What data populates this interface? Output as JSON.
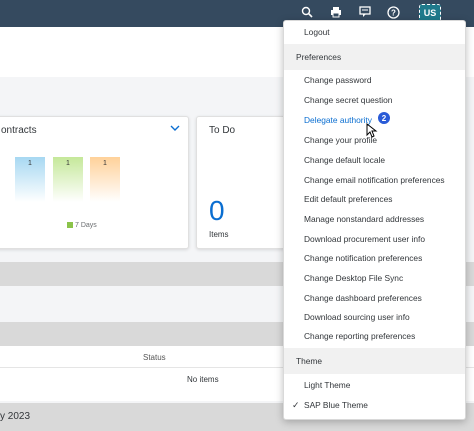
{
  "shell": {
    "avatar_initials": "US",
    "icons": [
      "search-icon",
      "printer-icon",
      "feedback-icon",
      "help-icon"
    ]
  },
  "cards": {
    "contracts": {
      "title": "ontracts",
      "bar_labels": [
        "1",
        "1",
        "1"
      ],
      "bar_colors": [
        "#a7d8f2",
        "#c5e89a",
        "#ffd19a"
      ],
      "legend": "7 Days"
    },
    "todo": {
      "title": "To Do",
      "count": "0",
      "count_label": "Items"
    }
  },
  "table": {
    "status_header": "Status",
    "empty_text": "No items"
  },
  "month_label": "y 2023",
  "menu": {
    "logout": "Logout",
    "preferences_header": "Preferences",
    "items": [
      "Change password",
      "Change secret question",
      "Delegate authority",
      "Change your profile",
      "Change default locale",
      "Change email notification preferences",
      "Edit default preferences",
      "Manage nonstandard addresses",
      "Download procurement user info",
      "Change notification preferences",
      "Change Desktop File Sync",
      "Change dashboard preferences",
      "Download sourcing user info",
      "Change reporting preferences"
    ],
    "theme_header": "Theme",
    "themes": [
      "Light Theme",
      "SAP Blue Theme"
    ],
    "selected_theme": "SAP Blue Theme"
  },
  "callout_number": "2",
  "colors": {
    "shell": "#354a5f",
    "accent": "#0a6ed1",
    "badge": "#2a5bd7"
  }
}
